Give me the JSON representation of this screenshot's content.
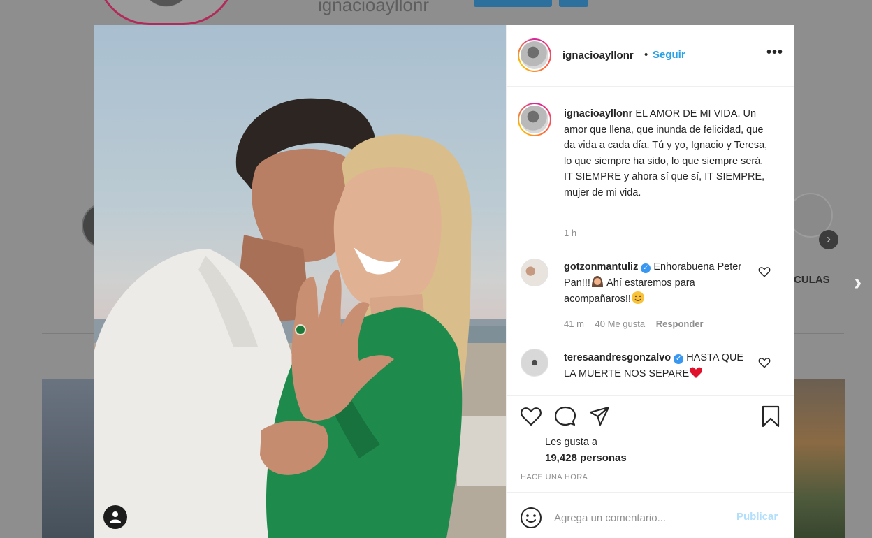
{
  "background": {
    "profile_username": "ignacioayllonr",
    "highlight_label": "CULAS"
  },
  "post": {
    "header": {
      "username": "ignacioayllonr",
      "separator": "•",
      "follow_label": "Seguir",
      "more_label": "•••"
    },
    "caption": {
      "username": "ignacioayllonr",
      "text": "EL AMOR DE MI VIDA. Un amor que llena, que inunda de felicidad, que da vida a cada día. Tú y yo, Ignacio y Teresa, lo que siempre ha sido, lo que siempre será. IT SIEMPRE y ahora sí que sí, IT SIEMPRE, mujer de mi vida.",
      "time": "1 h"
    },
    "comments": [
      {
        "username": "gotzonmantuliz",
        "verified": true,
        "text_1": "Enhorabuena Peter Pan!!!",
        "text_2": " Ahí estaremos para acompañaros!!",
        "emoji_1": "woman-with-headscarf-emoji",
        "emoji_2": "hugging-face-emoji",
        "time": "41 m",
        "likes": "40 Me gusta",
        "reply_label": "Responder"
      },
      {
        "username": "teresaandresgonzalvo",
        "verified": true,
        "text_1": "HASTA QUE LA MUERTE NOS SEPARE",
        "emoji_1": "red-heart-emoji"
      }
    ],
    "likes_label": "Les gusta a",
    "likes_count": "19,428 personas",
    "posted_ago": "HACE UNA HORA",
    "compose": {
      "placeholder": "Agrega un comentario...",
      "post_label": "Publicar"
    },
    "colors": {
      "link_blue": "#2aa1e6",
      "verified_blue": "#3897f0",
      "post_disabled": "#b2dffc",
      "text_primary": "#262626",
      "text_secondary": "#8e8e8e"
    }
  }
}
